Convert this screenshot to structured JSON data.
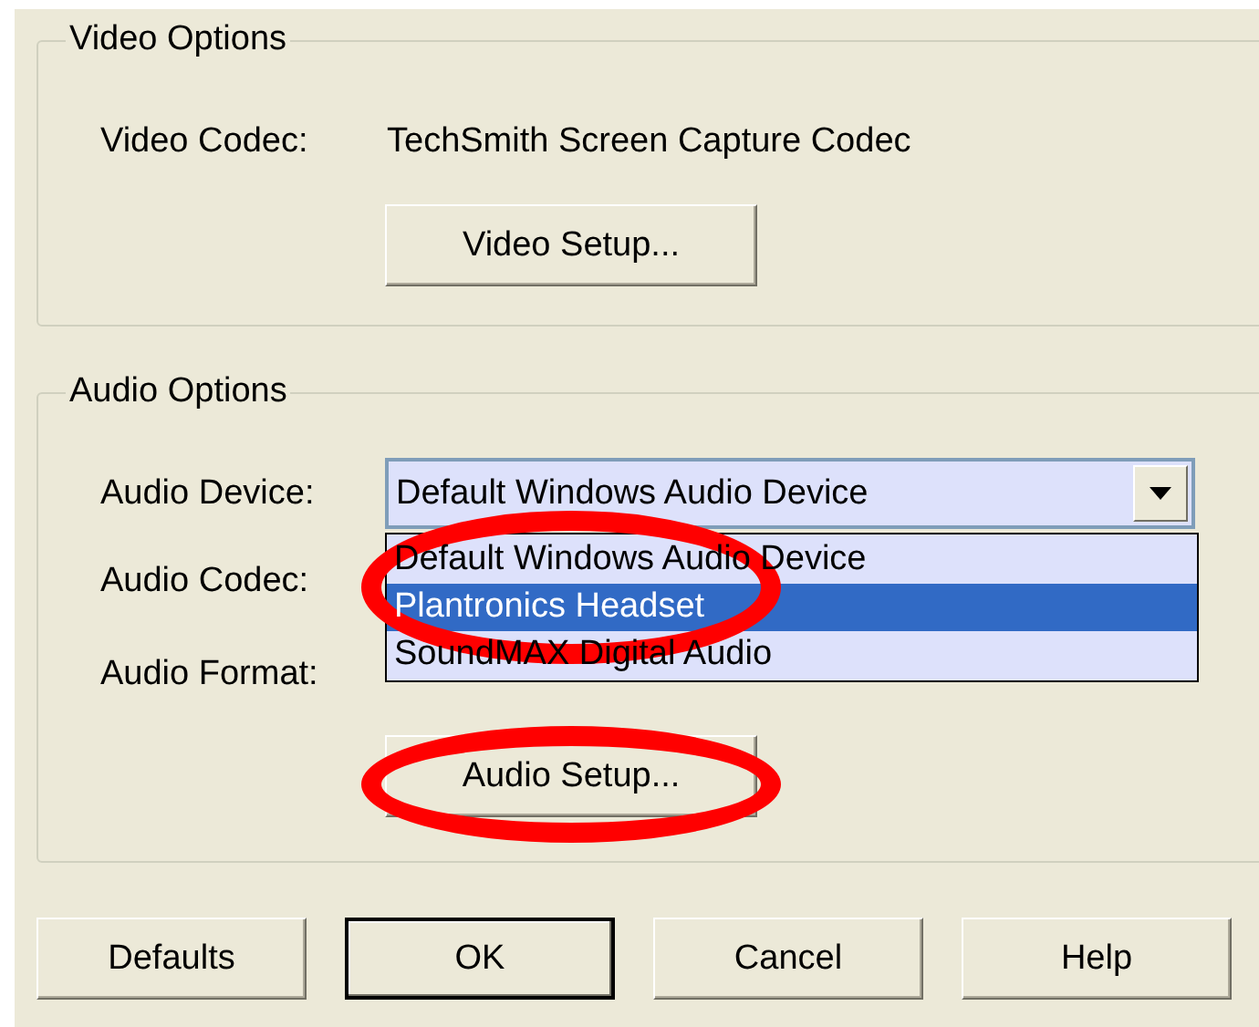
{
  "video_options": {
    "title": "Video Options",
    "codec_label": "Video Codec:",
    "codec_value": "TechSmith Screen Capture Codec",
    "setup_button": "Video Setup..."
  },
  "audio_options": {
    "title": "Audio Options",
    "device_label": "Audio Device:",
    "device_value": "Default Windows Audio Device",
    "dropdown": {
      "expanded": true,
      "items": [
        {
          "label": "Default Windows Audio Device",
          "selected": false
        },
        {
          "label": "Plantronics Headset",
          "selected": true
        },
        {
          "label": "SoundMAX Digital Audio",
          "selected": false
        }
      ]
    },
    "codec_label": "Audio Codec:",
    "format_label": "Audio Format:",
    "setup_button": "Audio Setup..."
  },
  "buttons": [
    {
      "label": "Defaults",
      "default": false
    },
    {
      "label": "OK",
      "default": true
    },
    {
      "label": "Cancel",
      "default": false
    },
    {
      "label": "Help",
      "default": false
    }
  ],
  "annotations": [
    {
      "kind": "ellipse"
    },
    {
      "kind": "ellipse"
    }
  ]
}
